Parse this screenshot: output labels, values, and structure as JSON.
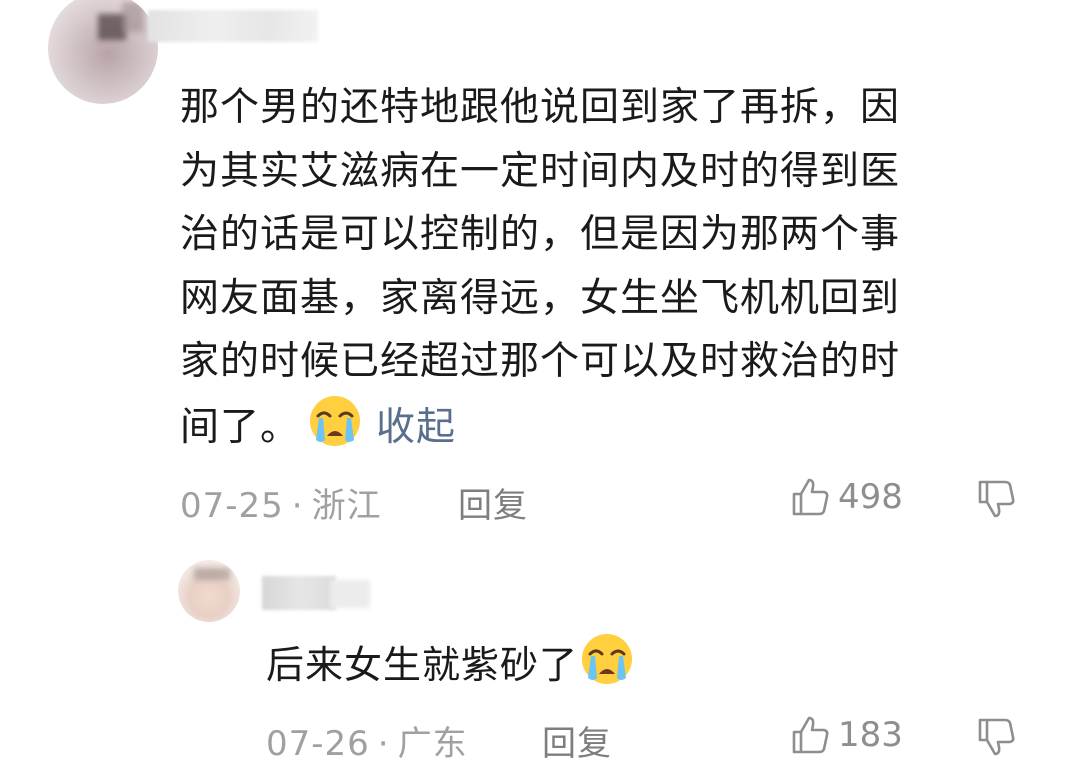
{
  "comment": {
    "lines": [
      "那个男的还特地跟他说回到家了再拆，因",
      "为其实艾滋病在一定时间内及时的得到医",
      "治的话是可以控制的，但是因为那两个事",
      "网友面基，家离得远，女生坐飞机机回到",
      "家的时候已经超过那个可以及时救治的时"
    ],
    "last_line": "间了。",
    "emoji_icon": "crying-face-emoji",
    "collapse_label": "收起",
    "date": "07-25",
    "separator": "·",
    "location": "浙江",
    "reply_label": "回复",
    "like_count": "498"
  },
  "reply": {
    "text": "后来女生就紫砂了",
    "emoji_icon": "crying-face-emoji",
    "date": "07-26",
    "separator": "·",
    "location": "广东",
    "reply_label": "回复",
    "like_count": "183"
  },
  "colors": {
    "text": "#1a1a1a",
    "meta": "#a0a0a0",
    "link": "#5b6f8c"
  }
}
